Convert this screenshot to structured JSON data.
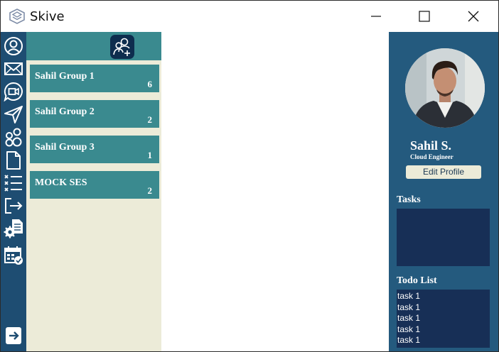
{
  "window": {
    "title": "Skive"
  },
  "sidebar": {
    "icons": [
      "profile-icon",
      "mail-icon",
      "video-chat-icon",
      "send-icon",
      "groups-icon",
      "document-icon",
      "checklist-icon",
      "logout-icon",
      "settings-document-icon",
      "calendar-check-icon",
      "exit-arrow-icon"
    ]
  },
  "groups": {
    "add_icon": "add-user-icon",
    "items": [
      {
        "name": "Sahil Group 1",
        "count": "6"
      },
      {
        "name": "Sahil Group 2",
        "count": "2"
      },
      {
        "name": "Sahil Group 3",
        "count": "1"
      },
      {
        "name": "MOCK SES",
        "count": "2"
      }
    ]
  },
  "profile": {
    "name": "Sahil S.",
    "role": "Cloud Engineer",
    "edit_label": "Edit Profile",
    "tasks_heading": "Tasks",
    "todo_heading": "Todo List",
    "todo_items": [
      "task 1",
      "task 1",
      "task 1",
      "task 1",
      "task 1"
    ]
  },
  "colors": {
    "iconbar": "#1e4d72",
    "group_card": "#3a8a8f",
    "groups_bg": "#ecebd8",
    "profile_panel": "#245a7e",
    "task_box": "#172f56"
  }
}
